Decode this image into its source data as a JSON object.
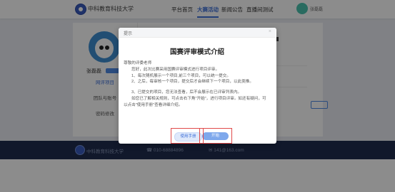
{
  "header": {
    "brand": "中科教育科技大学",
    "nav": [
      "平台首页",
      "大赛活动",
      "新闻公告",
      "直播间测试"
    ],
    "active_nav_index": 1,
    "user_name": "张磊磊",
    "accent": "#3d6fd8"
  },
  "sidebar": {
    "user_name": "张磊磊",
    "items": [
      {
        "label": "网评项目",
        "active": true
      },
      {
        "label": "团队与账号",
        "active": false
      },
      {
        "label": "密码修改",
        "active": false
      }
    ]
  },
  "footer": {
    "brand": "中科教育科技大学",
    "phone": "☎ 010-68884896",
    "email": "✉ 141@163.com"
  },
  "modal": {
    "header_label": "提示",
    "close_icon": "close-icon",
    "title": "国赛评审模式介绍",
    "greeting": "尊敬的评委老师",
    "paragraphs": [
      "您好，此次比赛采用国赛评审模式进行项目评审。",
      "1、每次随机展示一个项目,前三个项目，可以统一提交。",
      "2、之后，每审核一个项目，提交后才会继续下一个项目，以此类推。",
      "3、已提交的项目，您无法查看，后不会展示在已评审列表内。",
      "如您已了解相关规则，可点击右下角\"开始\"，进行项目评审。如还有疑问，可以点击\"使用手册\"查看详细介绍。"
    ],
    "buttons": {
      "manual": "使用手册",
      "start": "开始"
    }
  }
}
